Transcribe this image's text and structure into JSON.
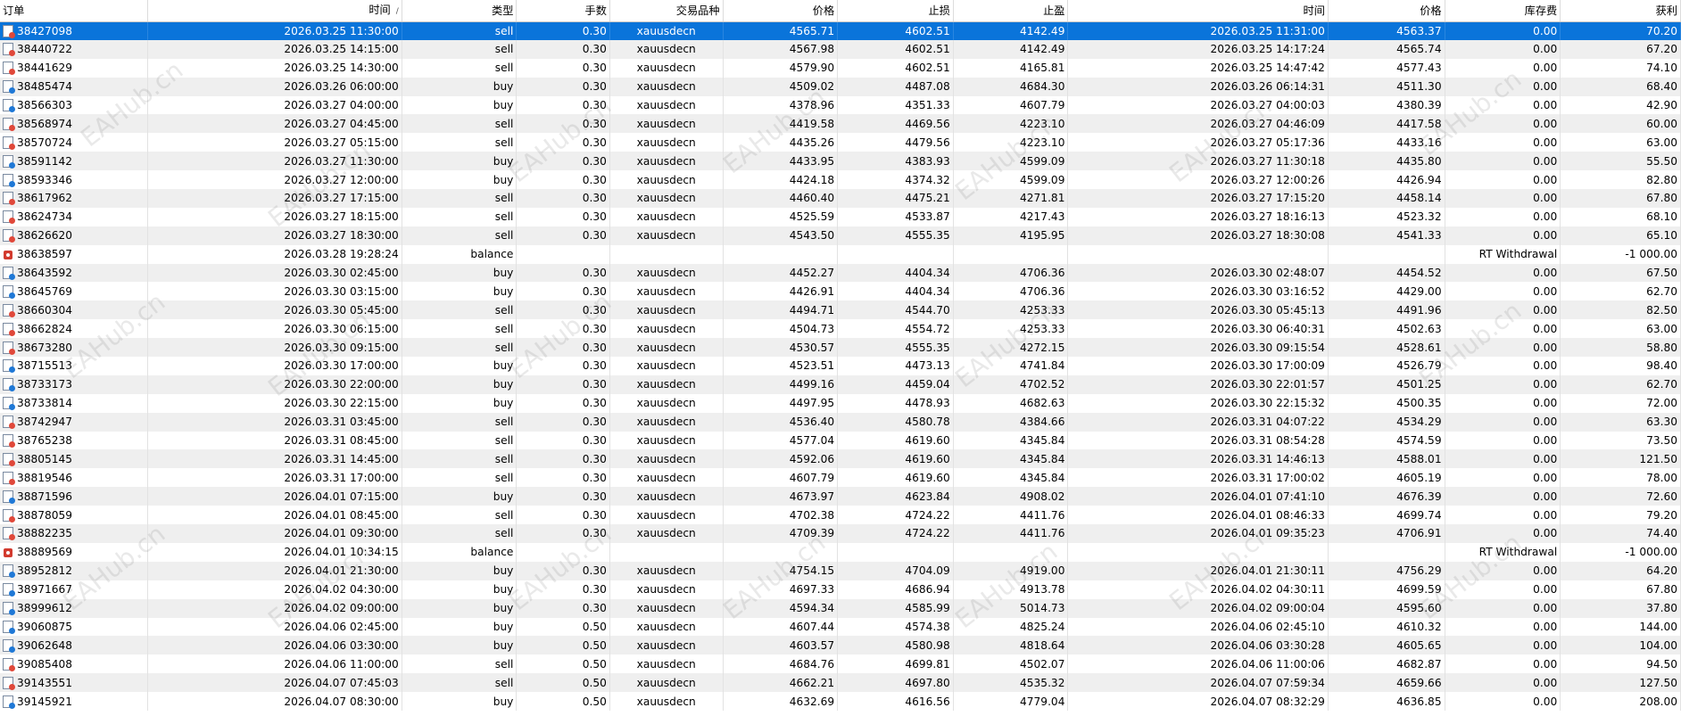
{
  "headers": [
    "订单",
    "时间",
    "类型",
    "手数",
    "交易品种",
    "价格",
    "止损",
    "止盈",
    "时间",
    "价格",
    "库存费",
    "获利"
  ],
  "sort_indicator": "/",
  "watermark": "EAHub.cn",
  "rows": [
    {
      "order": "38427098",
      "open_time": "2026.03.25 11:30:00",
      "type": "sell",
      "lots": "0.30",
      "symbol": "xauusdecn",
      "price": "4565.71",
      "sl": "4602.51",
      "tp": "4142.49",
      "close_time": "2026.03.25 11:31:00",
      "close_price": "4563.37",
      "swap": "0.00",
      "profit": "70.20",
      "selected": true
    },
    {
      "order": "38440722",
      "open_time": "2026.03.25 14:15:00",
      "type": "sell",
      "lots": "0.30",
      "symbol": "xauusdecn",
      "price": "4567.98",
      "sl": "4602.51",
      "tp": "4142.49",
      "close_time": "2026.03.25 14:17:24",
      "close_price": "4565.74",
      "swap": "0.00",
      "profit": "67.20"
    },
    {
      "order": "38441629",
      "open_time": "2026.03.25 14:30:00",
      "type": "sell",
      "lots": "0.30",
      "symbol": "xauusdecn",
      "price": "4579.90",
      "sl": "4602.51",
      "tp": "4165.81",
      "close_time": "2026.03.25 14:47:42",
      "close_price": "4577.43",
      "swap": "0.00",
      "profit": "74.10"
    },
    {
      "order": "38485474",
      "open_time": "2026.03.26 06:00:00",
      "type": "buy",
      "lots": "0.30",
      "symbol": "xauusdecn",
      "price": "4509.02",
      "sl": "4487.08",
      "tp": "4684.30",
      "close_time": "2026.03.26 06:14:31",
      "close_price": "4511.30",
      "swap": "0.00",
      "profit": "68.40"
    },
    {
      "order": "38566303",
      "open_time": "2026.03.27 04:00:00",
      "type": "buy",
      "lots": "0.30",
      "symbol": "xauusdecn",
      "price": "4378.96",
      "sl": "4351.33",
      "tp": "4607.79",
      "close_time": "2026.03.27 04:00:03",
      "close_price": "4380.39",
      "swap": "0.00",
      "profit": "42.90"
    },
    {
      "order": "38568974",
      "open_time": "2026.03.27 04:45:00",
      "type": "sell",
      "lots": "0.30",
      "symbol": "xauusdecn",
      "price": "4419.58",
      "sl": "4469.56",
      "tp": "4223.10",
      "close_time": "2026.03.27 04:46:09",
      "close_price": "4417.58",
      "swap": "0.00",
      "profit": "60.00"
    },
    {
      "order": "38570724",
      "open_time": "2026.03.27 05:15:00",
      "type": "sell",
      "lots": "0.30",
      "symbol": "xauusdecn",
      "price": "4435.26",
      "sl": "4479.56",
      "tp": "4223.10",
      "close_time": "2026.03.27 05:17:36",
      "close_price": "4433.16",
      "swap": "0.00",
      "profit": "63.00"
    },
    {
      "order": "38591142",
      "open_time": "2026.03.27 11:30:00",
      "type": "buy",
      "lots": "0.30",
      "symbol": "xauusdecn",
      "price": "4433.95",
      "sl": "4383.93",
      "tp": "4599.09",
      "close_time": "2026.03.27 11:30:18",
      "close_price": "4435.80",
      "swap": "0.00",
      "profit": "55.50"
    },
    {
      "order": "38593346",
      "open_time": "2026.03.27 12:00:00",
      "type": "buy",
      "lots": "0.30",
      "symbol": "xauusdecn",
      "price": "4424.18",
      "sl": "4374.32",
      "tp": "4599.09",
      "close_time": "2026.03.27 12:00:26",
      "close_price": "4426.94",
      "swap": "0.00",
      "profit": "82.80"
    },
    {
      "order": "38617962",
      "open_time": "2026.03.27 17:15:00",
      "type": "sell",
      "lots": "0.30",
      "symbol": "xauusdecn",
      "price": "4460.40",
      "sl": "4475.21",
      "tp": "4271.81",
      "close_time": "2026.03.27 17:15:20",
      "close_price": "4458.14",
      "swap": "0.00",
      "profit": "67.80"
    },
    {
      "order": "38624734",
      "open_time": "2026.03.27 18:15:00",
      "type": "sell",
      "lots": "0.30",
      "symbol": "xauusdecn",
      "price": "4525.59",
      "sl": "4533.87",
      "tp": "4217.43",
      "close_time": "2026.03.27 18:16:13",
      "close_price": "4523.32",
      "swap": "0.00",
      "profit": "68.10"
    },
    {
      "order": "38626620",
      "open_time": "2026.03.27 18:30:00",
      "type": "sell",
      "lots": "0.30",
      "symbol": "xauusdecn",
      "price": "4543.50",
      "sl": "4555.35",
      "tp": "4195.95",
      "close_time": "2026.03.27 18:30:08",
      "close_price": "4541.33",
      "swap": "0.00",
      "profit": "65.10"
    },
    {
      "order": "38638597",
      "open_time": "2026.03.28 19:28:24",
      "type": "balance",
      "comment": "RT Withdrawal",
      "profit": "-1 000.00"
    },
    {
      "order": "38643592",
      "open_time": "2026.03.30 02:45:00",
      "type": "buy",
      "lots": "0.30",
      "symbol": "xauusdecn",
      "price": "4452.27",
      "sl": "4404.34",
      "tp": "4706.36",
      "close_time": "2026.03.30 02:48:07",
      "close_price": "4454.52",
      "swap": "0.00",
      "profit": "67.50"
    },
    {
      "order": "38645769",
      "open_time": "2026.03.30 03:15:00",
      "type": "buy",
      "lots": "0.30",
      "symbol": "xauusdecn",
      "price": "4426.91",
      "sl": "4404.34",
      "tp": "4706.36",
      "close_time": "2026.03.30 03:16:52",
      "close_price": "4429.00",
      "swap": "0.00",
      "profit": "62.70"
    },
    {
      "order": "38660304",
      "open_time": "2026.03.30 05:45:00",
      "type": "sell",
      "lots": "0.30",
      "symbol": "xauusdecn",
      "price": "4494.71",
      "sl": "4544.70",
      "tp": "4253.33",
      "close_time": "2026.03.30 05:45:13",
      "close_price": "4491.96",
      "swap": "0.00",
      "profit": "82.50"
    },
    {
      "order": "38662824",
      "open_time": "2026.03.30 06:15:00",
      "type": "sell",
      "lots": "0.30",
      "symbol": "xauusdecn",
      "price": "4504.73",
      "sl": "4554.72",
      "tp": "4253.33",
      "close_time": "2026.03.30 06:40:31",
      "close_price": "4502.63",
      "swap": "0.00",
      "profit": "63.00"
    },
    {
      "order": "38673280",
      "open_time": "2026.03.30 09:15:00",
      "type": "sell",
      "lots": "0.30",
      "symbol": "xauusdecn",
      "price": "4530.57",
      "sl": "4555.35",
      "tp": "4272.15",
      "close_time": "2026.03.30 09:15:54",
      "close_price": "4528.61",
      "swap": "0.00",
      "profit": "58.80"
    },
    {
      "order": "38715513",
      "open_time": "2026.03.30 17:00:00",
      "type": "buy",
      "lots": "0.30",
      "symbol": "xauusdecn",
      "price": "4523.51",
      "sl": "4473.13",
      "tp": "4741.84",
      "close_time": "2026.03.30 17:00:09",
      "close_price": "4526.79",
      "swap": "0.00",
      "profit": "98.40"
    },
    {
      "order": "38733173",
      "open_time": "2026.03.30 22:00:00",
      "type": "buy",
      "lots": "0.30",
      "symbol": "xauusdecn",
      "price": "4499.16",
      "sl": "4459.04",
      "tp": "4702.52",
      "close_time": "2026.03.30 22:01:57",
      "close_price": "4501.25",
      "swap": "0.00",
      "profit": "62.70"
    },
    {
      "order": "38733814",
      "open_time": "2026.03.30 22:15:00",
      "type": "buy",
      "lots": "0.30",
      "symbol": "xauusdecn",
      "price": "4497.95",
      "sl": "4478.93",
      "tp": "4682.63",
      "close_time": "2026.03.30 22:15:32",
      "close_price": "4500.35",
      "swap": "0.00",
      "profit": "72.00"
    },
    {
      "order": "38742947",
      "open_time": "2026.03.31 03:45:00",
      "type": "sell",
      "lots": "0.30",
      "symbol": "xauusdecn",
      "price": "4536.40",
      "sl": "4580.78",
      "tp": "4384.66",
      "close_time": "2026.03.31 04:07:22",
      "close_price": "4534.29",
      "swap": "0.00",
      "profit": "63.30"
    },
    {
      "order": "38765238",
      "open_time": "2026.03.31 08:45:00",
      "type": "sell",
      "lots": "0.30",
      "symbol": "xauusdecn",
      "price": "4577.04",
      "sl": "4619.60",
      "tp": "4345.84",
      "close_time": "2026.03.31 08:54:28",
      "close_price": "4574.59",
      "swap": "0.00",
      "profit": "73.50"
    },
    {
      "order": "38805145",
      "open_time": "2026.03.31 14:45:00",
      "type": "sell",
      "lots": "0.30",
      "symbol": "xauusdecn",
      "price": "4592.06",
      "sl": "4619.60",
      "tp": "4345.84",
      "close_time": "2026.03.31 14:46:13",
      "close_price": "4588.01",
      "swap": "0.00",
      "profit": "121.50"
    },
    {
      "order": "38819546",
      "open_time": "2026.03.31 17:00:00",
      "type": "sell",
      "lots": "0.30",
      "symbol": "xauusdecn",
      "price": "4607.79",
      "sl": "4619.60",
      "tp": "4345.84",
      "close_time": "2026.03.31 17:00:02",
      "close_price": "4605.19",
      "swap": "0.00",
      "profit": "78.00"
    },
    {
      "order": "38871596",
      "open_time": "2026.04.01 07:15:00",
      "type": "buy",
      "lots": "0.30",
      "symbol": "xauusdecn",
      "price": "4673.97",
      "sl": "4623.84",
      "tp": "4908.02",
      "close_time": "2026.04.01 07:41:10",
      "close_price": "4676.39",
      "swap": "0.00",
      "profit": "72.60"
    },
    {
      "order": "38878059",
      "open_time": "2026.04.01 08:45:00",
      "type": "sell",
      "lots": "0.30",
      "symbol": "xauusdecn",
      "price": "4702.38",
      "sl": "4724.22",
      "tp": "4411.76",
      "close_time": "2026.04.01 08:46:33",
      "close_price": "4699.74",
      "swap": "0.00",
      "profit": "79.20"
    },
    {
      "order": "38882235",
      "open_time": "2026.04.01 09:30:00",
      "type": "sell",
      "lots": "0.30",
      "symbol": "xauusdecn",
      "price": "4709.39",
      "sl": "4724.22",
      "tp": "4411.76",
      "close_time": "2026.04.01 09:35:23",
      "close_price": "4706.91",
      "swap": "0.00",
      "profit": "74.40"
    },
    {
      "order": "38889569",
      "open_time": "2026.04.01 10:34:15",
      "type": "balance",
      "comment": "RT Withdrawal",
      "profit": "-1 000.00"
    },
    {
      "order": "38952812",
      "open_time": "2026.04.01 21:30:00",
      "type": "buy",
      "lots": "0.30",
      "symbol": "xauusdecn",
      "price": "4754.15",
      "sl": "4704.09",
      "tp": "4919.00",
      "close_time": "2026.04.01 21:30:11",
      "close_price": "4756.29",
      "swap": "0.00",
      "profit": "64.20"
    },
    {
      "order": "38971667",
      "open_time": "2026.04.02 04:30:00",
      "type": "buy",
      "lots": "0.30",
      "symbol": "xauusdecn",
      "price": "4697.33",
      "sl": "4686.94",
      "tp": "4913.78",
      "close_time": "2026.04.02 04:30:11",
      "close_price": "4699.59",
      "swap": "0.00",
      "profit": "67.80"
    },
    {
      "order": "38999612",
      "open_time": "2026.04.02 09:00:00",
      "type": "buy",
      "lots": "0.30",
      "symbol": "xauusdecn",
      "price": "4594.34",
      "sl": "4585.99",
      "tp": "5014.73",
      "close_time": "2026.04.02 09:00:04",
      "close_price": "4595.60",
      "swap": "0.00",
      "profit": "37.80"
    },
    {
      "order": "39060875",
      "open_time": "2026.04.06 02:45:00",
      "type": "buy",
      "lots": "0.50",
      "symbol": "xauusdecn",
      "price": "4607.44",
      "sl": "4574.38",
      "tp": "4825.24",
      "close_time": "2026.04.06 02:45:10",
      "close_price": "4610.32",
      "swap": "0.00",
      "profit": "144.00"
    },
    {
      "order": "39062648",
      "open_time": "2026.04.06 03:30:00",
      "type": "buy",
      "lots": "0.50",
      "symbol": "xauusdecn",
      "price": "4603.57",
      "sl": "4580.98",
      "tp": "4818.64",
      "close_time": "2026.04.06 03:30:28",
      "close_price": "4605.65",
      "swap": "0.00",
      "profit": "104.00"
    },
    {
      "order": "39085408",
      "open_time": "2026.04.06 11:00:00",
      "type": "sell",
      "lots": "0.50",
      "symbol": "xauusdecn",
      "price": "4684.76",
      "sl": "4699.81",
      "tp": "4502.07",
      "close_time": "2026.04.06 11:00:06",
      "close_price": "4682.87",
      "swap": "0.00",
      "profit": "94.50"
    },
    {
      "order": "39143551",
      "open_time": "2026.04.07 07:45:03",
      "type": "sell",
      "lots": "0.50",
      "symbol": "xauusdecn",
      "price": "4662.21",
      "sl": "4697.80",
      "tp": "4535.32",
      "close_time": "2026.04.07 07:59:34",
      "close_price": "4659.66",
      "swap": "0.00",
      "profit": "127.50"
    },
    {
      "order": "39145921",
      "open_time": "2026.04.07 08:30:00",
      "type": "buy",
      "lots": "0.50",
      "symbol": "xauusdecn",
      "price": "4632.69",
      "sl": "4616.56",
      "tp": "4779.04",
      "close_time": "2026.04.07 08:32:29",
      "close_price": "4636.85",
      "swap": "0.00",
      "profit": "208.00"
    }
  ]
}
